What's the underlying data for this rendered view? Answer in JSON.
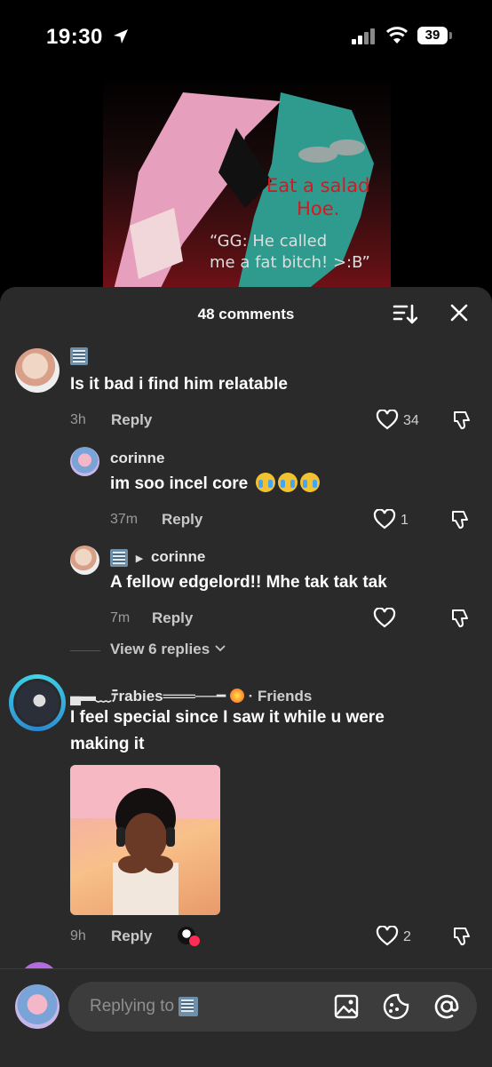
{
  "status_bar": {
    "time": "19:30",
    "battery": "39"
  },
  "video": {
    "caption_red_line1": "Eat a salad",
    "caption_red_line2": "Hoe.",
    "caption_white_line1": "“GG: He called",
    "caption_white_line2": "me a fat bitch! >:B”"
  },
  "sheet": {
    "comment_count": "48 comments"
  },
  "comments": [
    {
      "text": "Is it bad i find him relatable",
      "time": "3h",
      "reply_label": "Reply",
      "likes": "34"
    },
    {
      "username": "corinne",
      "text": "im soo incel core",
      "time": "37m",
      "reply_label": "Reply",
      "likes": "1"
    },
    {
      "reply_to": "corinne",
      "text": "A fellow edgelord!! Mhe tak tak tak",
      "time": "7m",
      "reply_label": "Reply"
    },
    {
      "username": "▄▬﹏ﾃrabies═══──━",
      "badge": "· Friends",
      "text_line1": "I feel special since I saw it while u were",
      "text_line2": "making it",
      "time": "9h",
      "reply_label": "Reply",
      "likes": "2"
    }
  ],
  "view_replies": "View 6 replies",
  "input": {
    "placeholder": "Replying to"
  },
  "icons": [
    "location-arrow-icon",
    "signal-icon",
    "wifi-icon",
    "battery-icon",
    "sort-icon",
    "close-icon",
    "heart-icon",
    "dislike-icon",
    "chevron-down-icon",
    "image-icon",
    "sticker-icon",
    "mention-icon",
    "xray-badge-icon",
    "sob-emoji-icon",
    "heart-emoji-icon"
  ],
  "colors": {
    "sheet_bg": "#2a2a2a",
    "input_bg": "#3c3c3c",
    "caption_red": "#e0141c"
  }
}
